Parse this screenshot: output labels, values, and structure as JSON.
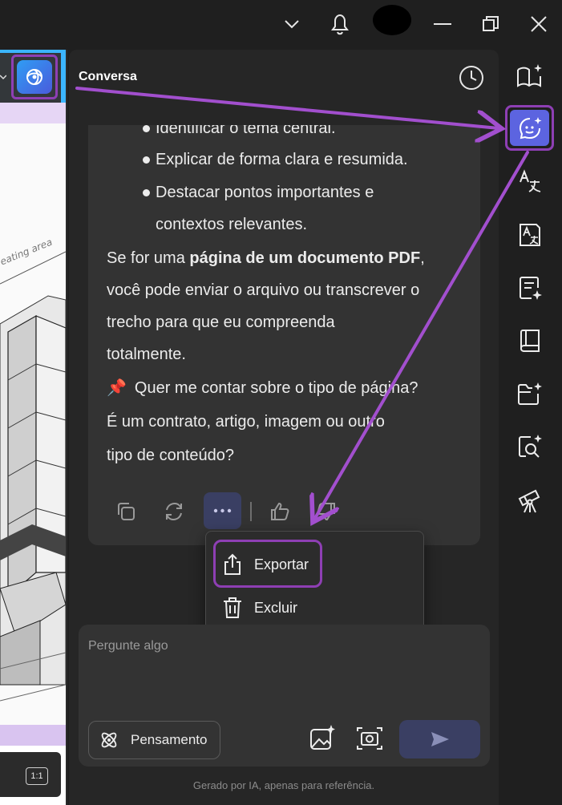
{
  "chat": {
    "title": "Conversa",
    "message_lines": [
      "Identificar o tema central.",
      "Explicar de forma clara e resumida.",
      "Destacar pontos importantes e",
      "contextos relevantes."
    ],
    "para1": {
      "prefix": "Se for uma ",
      "bold": "página de um documento PDF",
      "suffix": ",",
      "line2": "você pode enviar o arquivo ou transcrever o",
      "line3": "trecho para que eu compreenda",
      "line4": "totalmente."
    },
    "para2": {
      "emoji": "📌",
      "line1": "Quer me contar sobre o tipo de página?",
      "line2": "É um contrato, artigo, imagem ou outro",
      "line3": "tipo de conteúdo?"
    }
  },
  "menu": {
    "items": [
      {
        "label": "Exportar",
        "icon": "share-icon"
      },
      {
        "label": "Excluir",
        "icon": "trash-icon"
      }
    ]
  },
  "input": {
    "placeholder": "Pergunte algo",
    "thinking_label": "Pensamento"
  },
  "footer": {
    "disclaimer": "Gerado por IA, apenas para referência."
  },
  "doc": {
    "ratio_label": "1:1",
    "sketch_label": "eating area"
  },
  "colors": {
    "accent": "#5c64e0",
    "highlight": "#8e3fb4",
    "panel": "#262626",
    "card": "#333333"
  }
}
